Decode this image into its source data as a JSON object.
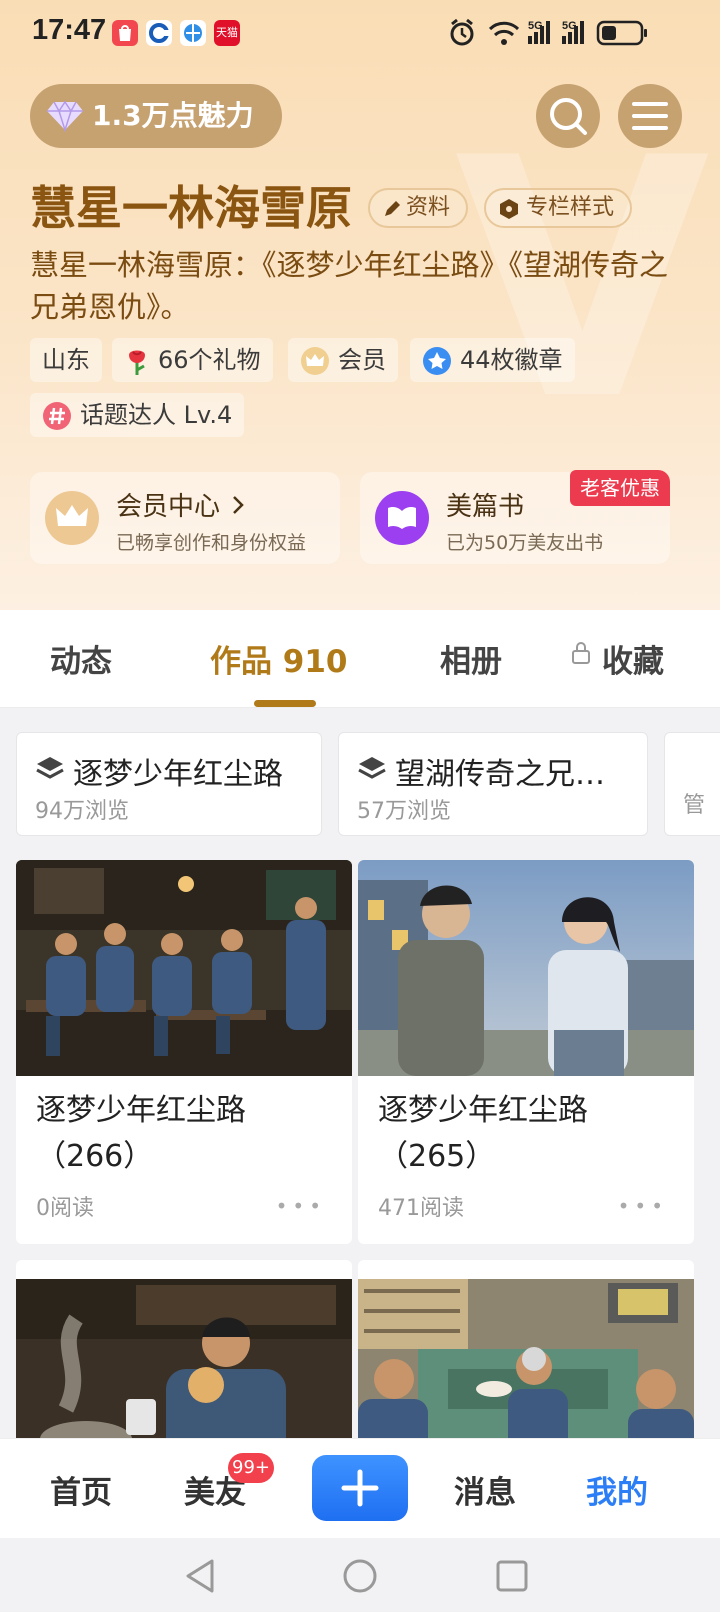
{
  "status_bar": {
    "time": "17:47",
    "tmall_label": "天猫",
    "network_1": "5G",
    "network_2": "5G"
  },
  "charm": {
    "label": "1.3万点魅力"
  },
  "profile": {
    "name": "慧星一林海雪原",
    "info_button": "资料",
    "style_button": "专栏样式",
    "bio": "慧星一林海雪原：《逐梦少年红尘路》《望湖传奇之兄弟恩仇》。",
    "tags": {
      "region": "山东",
      "gifts": "66个礼物",
      "member": "会员",
      "badges": "44枚徽章",
      "topic": "话题达人 Lv.4"
    }
  },
  "cards": {
    "member_center": {
      "title": "会员中心",
      "subtitle": "已畅享创作和身份权益"
    },
    "book": {
      "title": "美篇书",
      "subtitle": "已为50万美友出书",
      "promo": "老客优惠"
    }
  },
  "tabs": [
    {
      "label": "动态"
    },
    {
      "label": "作品 910"
    },
    {
      "label": "相册"
    },
    {
      "label": "收藏"
    }
  ],
  "collections": [
    {
      "title": "逐梦少年红尘路",
      "views": "94万浏览"
    },
    {
      "title": "望湖传奇之兄…",
      "views": "57万浏览"
    },
    {
      "title": "管"
    }
  ],
  "works": [
    {
      "title": "逐梦少年红尘路（266）",
      "reads": "0阅读"
    },
    {
      "title": "逐梦少年红尘路（265）",
      "reads": "471阅读"
    },
    {
      "title": ""
    },
    {
      "title": ""
    }
  ],
  "bottom_nav": {
    "home": "首页",
    "friends": "美友",
    "friends_badge": "99+",
    "messages": "消息",
    "mine": "我的"
  },
  "colors": {
    "accent_gold": "#b07a18",
    "nav_active_blue": "#2b7ef6",
    "promo_red": "#ec3b4e"
  }
}
